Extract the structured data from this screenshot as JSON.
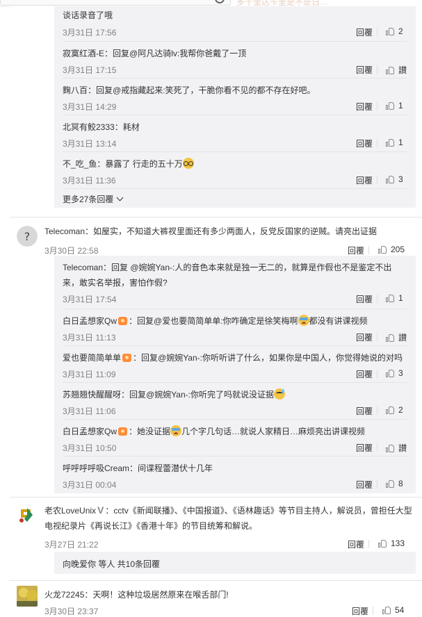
{
  "colors": {
    "panel_bg": "#f2f2f5",
    "time": "#808080",
    "text": "#333333"
  },
  "top": {
    "blurred_text": "多千里达卡里是不是日…"
  },
  "thread1": {
    "replies": [
      {
        "user": "",
        "text": "谈话录音了哦",
        "time": "3月31日 17:56",
        "reply": "回覆",
        "likes": "2"
      },
      {
        "user": "寂寞红酒-E",
        "text": "：回复@阿凡达骑lv:我帮你爸戴了一顶",
        "time": "3月31日 17:15",
        "reply": "回覆",
        "likes": "讃"
      },
      {
        "user": "麴八百",
        "text": "：回复@戒指藏起来:笑死了，干脆你看不见的都不存在好吧。",
        "time": "3月31日 14:29",
        "reply": "回覆",
        "likes": "1"
      },
      {
        "user": "北冥有鲛2333",
        "text": "：耗材",
        "time": "3月31日 13:14",
        "reply": "回覆",
        "likes": "1"
      },
      {
        "user": "不_吃_鱼",
        "text": "：暴露了 行走的五十万",
        "time": "3月31日 11:36",
        "reply": "回覆",
        "likes": "3"
      }
    ],
    "more_label": "更多27条回覆"
  },
  "comment2": {
    "user": "Telecoman",
    "text": "：如屋实，不知道大裤衩里面还有多少两面人，反党反国家的逆贼。请亮出证据",
    "time": "3月30日 22:58",
    "reply": "回覆",
    "likes": "205",
    "replies": [
      {
        "user": "Telecoman",
        "text": "：回复 @婉婉Yan-:人的音色本来就是独一无二的，就算是作假也不是鉴定不出来，敢实名举报，害怕作假?",
        "time": "3月31日 17:54",
        "reply": "回覆",
        "likes": "1"
      },
      {
        "user": "白日孟想家Qw",
        "text": "：回复@爱也要简简单单:你咋确定是徐笑梅啊",
        "text2": "都没有讲课视频",
        "time": "3月31日 11:13",
        "reply": "回覆",
        "likes": "讃"
      },
      {
        "user": "爱也要简简单单",
        "text": "：回复@婉婉Yan-:你听听讲了什么，如果你是中国人，你觉得她说的对吗",
        "time": "3月31日 11:09",
        "reply": "回覆",
        "likes": "3"
      },
      {
        "user": "苏翘翘快醒醒呀",
        "text": "：回复@婉婉Yan-:你听完了吗就说没证据",
        "time": "3月31日 11:06",
        "reply": "回覆",
        "likes": "2"
      },
      {
        "user": "白日孟想家Qw",
        "text": "：她没证据",
        "text2": "几个字几句话…就说人家精日…麻烦亮出讲课视频",
        "time": "3月31日 10:50",
        "reply": "回覆",
        "likes": "讃"
      },
      {
        "user": "呼呼呼呼吸Cream",
        "text": "：间谍程蕾潜伏十几年",
        "time": "3月31日 00:04",
        "reply": "回覆",
        "likes": "8"
      }
    ]
  },
  "comment3": {
    "user": "老农LoveUnix",
    "text": "：cctv《新闻联播》、《中国报道》、《语林趣话》等节目主持人，解说员，曾担任大型电视纪录片《再说长江》《香港十年》的节目统筹和解说。",
    "time": "3月27日 21:22",
    "reply": "回覆",
    "likes": "133",
    "footer": "向晚爱你 等人 共10条回覆"
  },
  "comment4": {
    "user": "火龙72245",
    "text": "：天啊！这种垃圾居然原来在喉舌部门!",
    "time": "3月30日 23:37",
    "reply": "回覆",
    "likes": "54"
  }
}
